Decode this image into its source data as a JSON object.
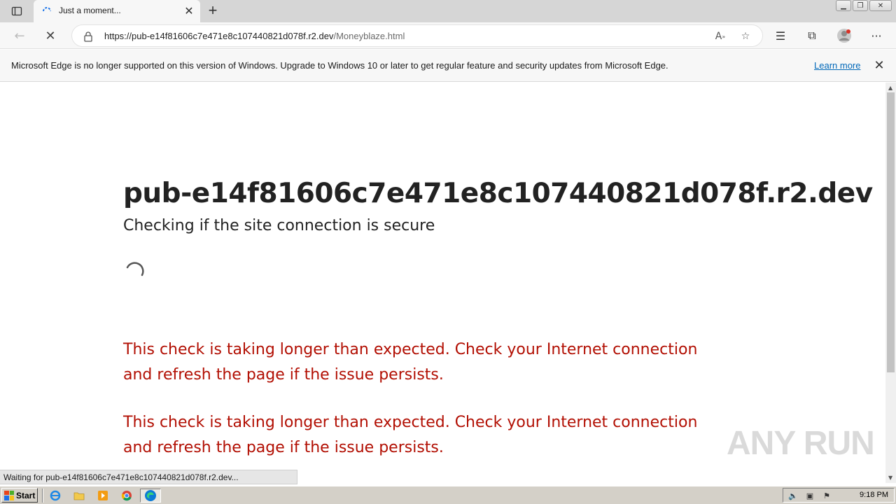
{
  "browser": {
    "tab": {
      "title": "Just a moment..."
    },
    "address": {
      "host": "https://pub-e14f81606c7e471e8c107440821d078f.r2.dev",
      "path": "/Moneyblaze.html"
    },
    "infobar": {
      "message": "Microsoft Edge is no longer supported on this version of Windows. Upgrade to Windows 10 or later to get regular feature and security updates from Microsoft Edge.",
      "link": "Learn more"
    },
    "status": "Waiting for pub-e14f81606c7e471e8c107440821d078f.r2.dev..."
  },
  "page": {
    "heading": "pub-e14f81606c7e471e8c107440821d078f.r2.dev",
    "subheading": "Checking if the site connection is secure",
    "warnings": [
      "This check is taking longer than expected. Check your Internet connection and refresh the page if the issue persists.",
      "This check is taking longer than expected. Check your Internet connection and refresh the page if the issue persists."
    ],
    "warning_color": "#b20f03"
  },
  "watermark": "ANY RUN",
  "taskbar": {
    "start_label": "Start",
    "clock": "9:18 PM",
    "quick_launch": [
      "ie-icon",
      "folder-icon",
      "media-player-icon",
      "chrome-icon",
      "edge-icon"
    ]
  }
}
